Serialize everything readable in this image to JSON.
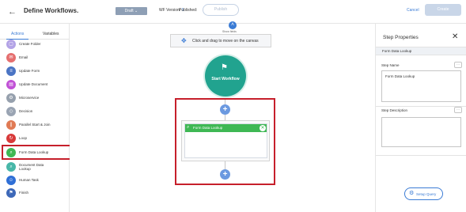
{
  "header": {
    "back_icon": "arrow-left-icon",
    "title": "Define Workflows.",
    "status_label": "Draft",
    "version_label": "WF Version:",
    "version_value": "1",
    "published_label": "Published:",
    "publish_label": "Publish",
    "cancel_label": "Cancel",
    "create_label": "Create"
  },
  "left_panel": {
    "tabs": [
      {
        "label": "Actions",
        "active": true
      },
      {
        "label": "Variables",
        "active": false
      }
    ],
    "items": [
      {
        "label": "Create Folder",
        "icon": "folder-icon",
        "color": "#b3a3e6"
      },
      {
        "label": "Email",
        "icon": "email-icon",
        "color": "#e56f6f"
      },
      {
        "label": "Update Form",
        "icon": "form-icon",
        "color": "#4b74c4"
      },
      {
        "label": "Update Document",
        "icon": "document-icon",
        "color": "#c151d6"
      },
      {
        "label": "Microservice",
        "icon": "microservice-icon",
        "color": "#96a0ad"
      },
      {
        "label": "Decision",
        "icon": "decision-icon",
        "color": "#9aa4b3"
      },
      {
        "label": "Parallel Start & Join",
        "icon": "parallel-icon",
        "color": "#e07a54"
      },
      {
        "label": "Loop",
        "icon": "loop-icon",
        "color": "#d83a3a"
      },
      {
        "label": "Form Data Lookup",
        "icon": "lookup-icon",
        "color": "#3fb854"
      },
      {
        "label": "Document Data Lookup",
        "icon": "doc-lookup-icon",
        "color": "#48b7a8"
      },
      {
        "label": "Human Task",
        "icon": "human-icon",
        "color": "#2f6fd6"
      },
      {
        "label": "Finish",
        "icon": "finish-icon",
        "color": "#3d68b8"
      }
    ]
  },
  "canvas": {
    "show_fields_label": "Show fields",
    "hint_text": "Click and drag to move on the canvas",
    "start_node_label": "Start Workflow",
    "step_name": "Form Data Lookup"
  },
  "right_panel": {
    "title": "Step Properties",
    "subtitle": "Form Data Lookup",
    "step_name_label": "Step Name",
    "step_name_value": "Form Data Lookup",
    "step_description_label": "Step Description",
    "step_description_value": "",
    "setup_query_label": "Setup Query"
  },
  "colors": {
    "accent": "#3a7bd5",
    "start_node": "#21a38f",
    "step_header": "#3fb854",
    "highlight": "#c61f2b"
  }
}
